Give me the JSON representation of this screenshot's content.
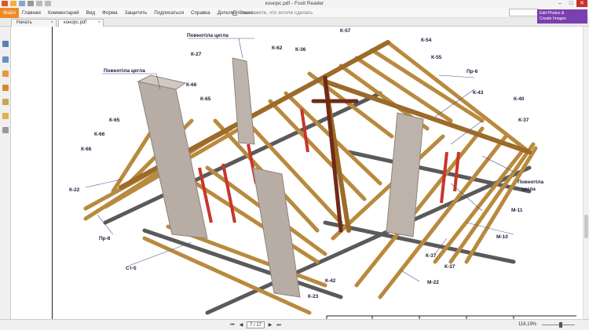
{
  "window": {
    "title": "конорс.pdf - Foxit Reader",
    "controls": {
      "minimize": "–",
      "maximize": "□",
      "close": "✕"
    }
  },
  "ribbon": {
    "file_label": "Файл",
    "menu_items": [
      "Главная",
      "Комментарий",
      "Вид",
      "Форма",
      "Защитить",
      "Подписаться",
      "Справка",
      "Дополнительно"
    ],
    "search_hint": "Расскажите, что хотите сделать",
    "promo": [
      "Edit Photos &",
      "Create Images"
    ]
  },
  "tabs": [
    {
      "label": "Начать",
      "close": "×"
    },
    {
      "label": "конорс.pdf",
      "close": "×"
    }
  ],
  "status": {
    "page_current": "7 / 17",
    "zoom": "116,19%",
    "nav": {
      "first": "⏮",
      "prev": "◀",
      "next": "▶",
      "last": "⏭"
    }
  },
  "drawing": {
    "labels": {
      "pov_left": "Повнотіла цегла",
      "pov_top": "Повнотіла цегла",
      "pov_right": "Повнотіла\nцегла",
      "k57": "К-57",
      "k54": "К-54",
      "k55": "К-55",
      "k62": "К-62",
      "k36": "К-36",
      "k27": "К-27",
      "k66a": "К-66",
      "k65a": "К-65",
      "k65b": "К-65",
      "k66b": "К-66",
      "k66c": "К-66",
      "k22": "К-22",
      "pr8": "Пр-8",
      "st5": "Ст-5",
      "pr6": "Пр-6",
      "k43": "К-43",
      "k40": "К-40",
      "k37a": "К-37",
      "m11": "М-11",
      "m10": "М-10",
      "k37b": "К-37",
      "k37c": "К-37",
      "m22": "М-22",
      "k42": "К-42",
      "k23": "К-23"
    }
  }
}
